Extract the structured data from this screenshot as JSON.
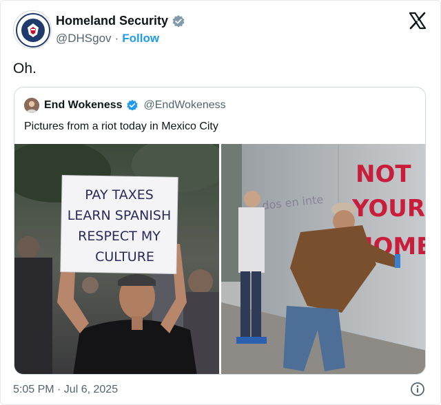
{
  "author": {
    "name": "Homeland Security",
    "handle": "@DHSgov",
    "separator": "·",
    "follow_label": "Follow"
  },
  "tweet": {
    "text": "Oh.",
    "timestamp": "5:05 PM · Jul 6, 2025"
  },
  "quoted": {
    "name": "End Wokeness",
    "handle": "@EndWokeness",
    "text": "Pictures from a riot today in Mexico City",
    "images": {
      "left": {
        "sign_lines": [
          "PAY TAXES",
          "LEARN SPANISH",
          "RESPECT MY",
          "CULTURE"
        ]
      },
      "right": {
        "graffiti_lines": [
          "NOT",
          "YOUR",
          "HOME"
        ]
      }
    }
  },
  "colors": {
    "accent": "#1d9bf0",
    "text_primary": "#0f1419",
    "text_secondary": "#536471",
    "border": "#cfd9de",
    "graffiti": "#c81e3c"
  },
  "icons": {
    "verified": "verified-badge-icon",
    "x_logo": "x-logo-icon",
    "info": "info-icon"
  }
}
